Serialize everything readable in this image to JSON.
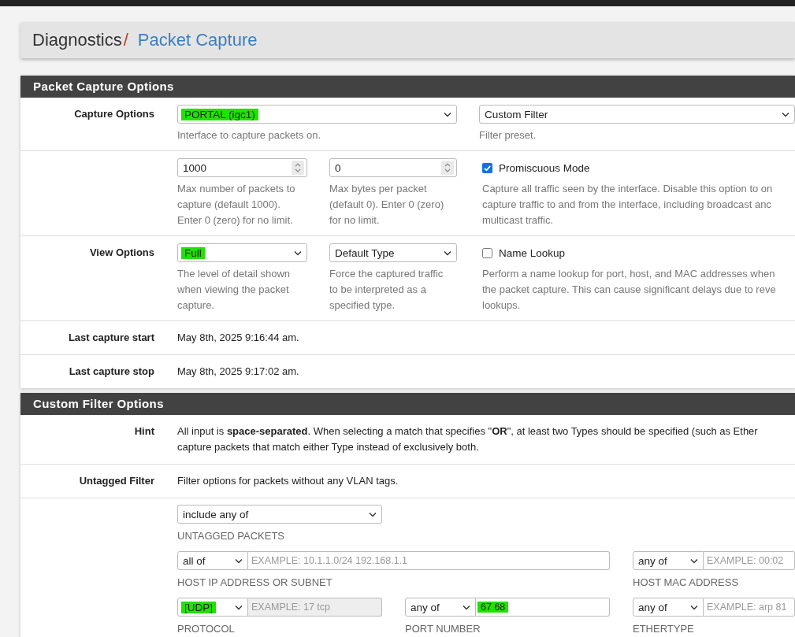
{
  "breadcrumb": {
    "section": "Diagnostics",
    "separator": "/",
    "page": "Packet Capture"
  },
  "panels": [
    {
      "title": "Packet Capture Options",
      "rows": [
        {
          "kind": "options",
          "label": "Capture Options",
          "cells": [
            {
              "kind": "wide-select",
              "value": "PORTAL (igc1)",
              "highlighted": true,
              "help": [
                "Interface to capture packets on."
              ]
            },
            {
              "kind": "select",
              "value": "Custom Filter",
              "highlighted": false,
              "help": [
                "Filter preset."
              ]
            }
          ]
        },
        {
          "kind": "options",
          "cells": [
            {
              "kind": "number",
              "value": "1000",
              "help": [
                "Max number of packets to",
                "capture (default 1000).",
                "Enter 0 (zero) for no limit."
              ]
            },
            {
              "kind": "number",
              "value": "0",
              "help": [
                "Max bytes per packet",
                "(default 0). Enter 0 (zero)",
                "for no limit."
              ]
            },
            {
              "kind": "checkbox",
              "text": "Promiscuous Mode",
              "checked": true,
              "help": [
                "Capture all traffic seen by the interface. Disable this option to on",
                "capture traffic to and from the interface, including broadcast anc",
                "multicast traffic."
              ]
            }
          ]
        },
        {
          "kind": "options",
          "label": "View Options",
          "cells": [
            {
              "kind": "select",
              "value": "Full",
              "highlighted": true,
              "help": [
                "The level of detail shown",
                "when viewing the packet",
                "capture."
              ]
            },
            {
              "kind": "select",
              "value": "Default Type",
              "highlighted": false,
              "help": [
                "Force the captured traffic",
                "to be interpreted as a",
                "specified type."
              ]
            },
            {
              "kind": "checkbox",
              "text": "Name Lookup",
              "checked": false,
              "help": [
                "Perform a name lookup for port, host, and MAC addresses when",
                "the packet capture. This can cause significant delays due to reve",
                "lookups."
              ]
            }
          ]
        },
        {
          "kind": "info",
          "label": "Last capture start",
          "lines": [
            "May 8th, 2025 9:16:44 am."
          ]
        },
        {
          "kind": "info",
          "label": "Last capture stop",
          "lines": [
            "May 8th, 2025 9:17:02 am."
          ]
        }
      ]
    },
    {
      "title": "Custom Filter Options",
      "rows": [
        {
          "kind": "info",
          "label": "Hint",
          "lines": [
            "All input is **space-separated**. When selecting a match that specifies \"**OR**\", at least two Types should be specified (such as Ether",
            "capture packets that match either Type instead of exclusively both."
          ]
        },
        {
          "kind": "info",
          "label": "Untagged Filter",
          "lines": [
            "Filter options for packets without any VLAN tags."
          ]
        },
        {
          "kind": "filter",
          "lines": [
            [
              {
                "kind": "select",
                "match": "include any of",
                "highlighted": false,
                "caption": "UNTAGGED PACKETS"
              }
            ],
            [
              {
                "kind": "wide",
                "match": "all of",
                "highlighted": false,
                "placeholder": "EXAMPLE: 10.1.1.0/24 192.168.1.1",
                "disabled": false,
                "caption": "HOST IP ADDRESS OR SUBNET"
              },
              {
                "kind": "normal",
                "match": "any of",
                "highlighted": false,
                "placeholder": "EXAMPLE: 00:02",
                "disabled": false,
                "caption": "HOST MAC ADDRESS"
              }
            ],
            [
              {
                "kind": "normal",
                "match": "[UDP]",
                "highlighted": true,
                "placeholder": "EXAMPLE: 17 tcp",
                "disabled": true,
                "caption": "PROTOCOL"
              },
              {
                "kind": "normal",
                "match": "any of",
                "highlighted": false,
                "value": "67 68",
                "value_highlighted": true,
                "disabled": false,
                "caption": "PORT NUMBER"
              },
              {
                "kind": "normal",
                "match": "any of",
                "highlighted": false,
                "placeholder": "EXAMPLE: arp 81",
                "disabled": false,
                "caption": "ETHERTYPE"
              }
            ]
          ]
        }
      ]
    }
  ]
}
